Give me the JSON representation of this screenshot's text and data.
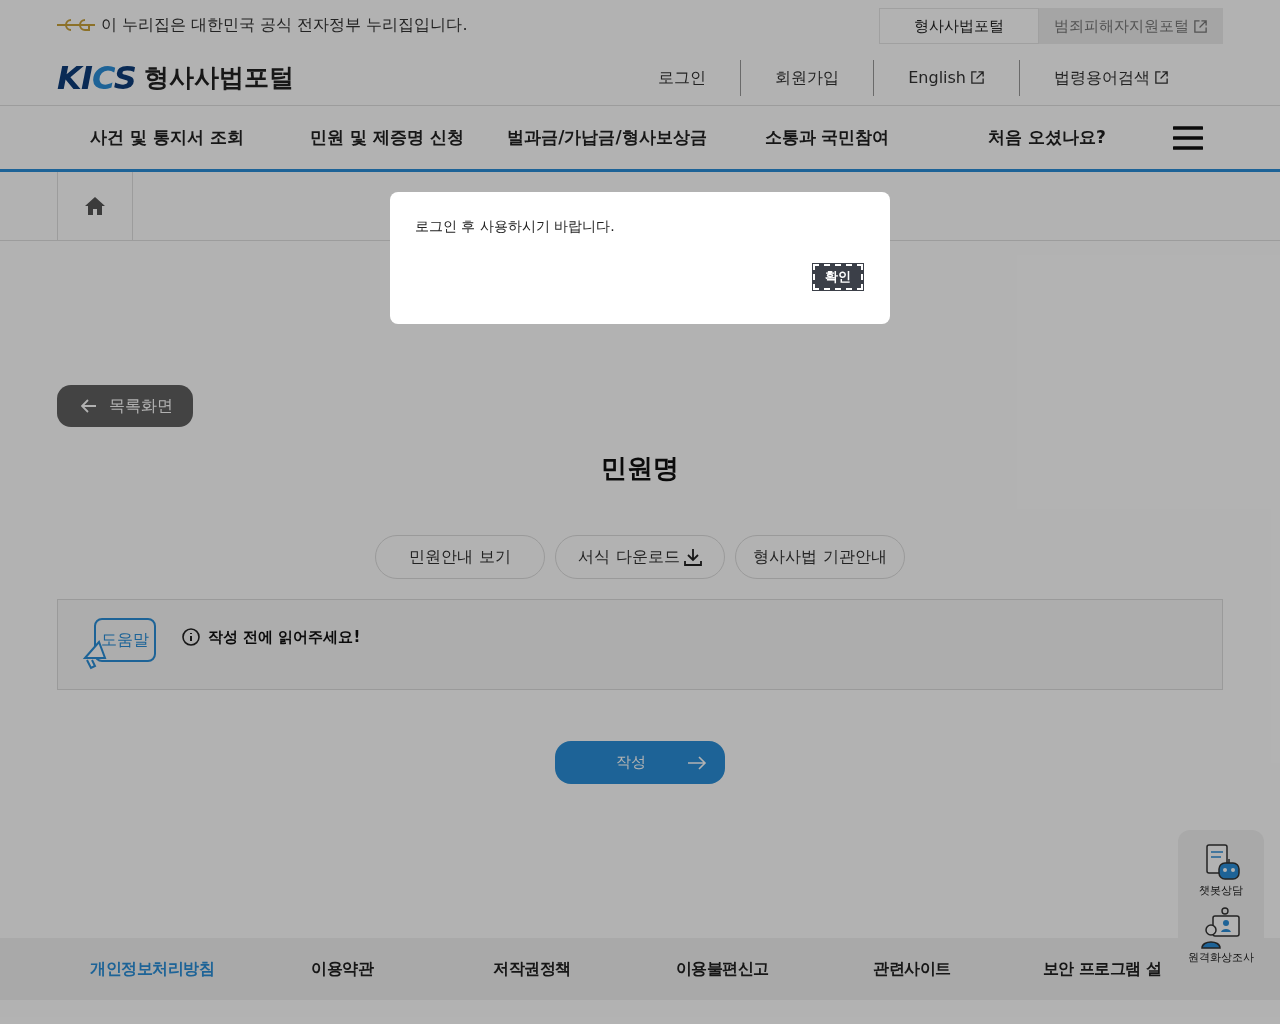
{
  "gov_banner": {
    "text": "이 누리집은 대한민국 공식 전자정부 누리집입니다."
  },
  "portal_tabs": [
    {
      "label": "형사사법포털",
      "selected": true,
      "external": false
    },
    {
      "label": "범죄피해자지원포털",
      "selected": false,
      "external": true
    }
  ],
  "logo": {
    "brand": "KICS",
    "title": "형사사법포털"
  },
  "utility_links": [
    {
      "label": "로그인",
      "external": false
    },
    {
      "label": "회원가입",
      "external": false
    },
    {
      "label": "English",
      "external": true
    },
    {
      "label": "법령용어검색",
      "external": true
    }
  ],
  "main_nav": [
    "사건 및 통지서 조회",
    "민원 및 제증명 신청",
    "벌과금/가납금/형사보상금",
    "소통과 국민참여",
    "처음 오셨나요?"
  ],
  "back_button": {
    "label": "목록화면"
  },
  "section_title": "민원명",
  "actions": [
    {
      "label": "민원안내 보기",
      "kind": "plain"
    },
    {
      "label": "서식 다운로드",
      "kind": "download"
    },
    {
      "label": "형사사법 기관안내",
      "kind": "plain"
    }
  ],
  "help_box": {
    "badge": "도움말",
    "notice": "작성 전에 읽어주세요!"
  },
  "submit_button": {
    "label": "작성"
  },
  "footer_links": [
    {
      "label": "개인정보처리방침",
      "highlighted": true
    },
    {
      "label": "이용약관",
      "highlighted": false
    },
    {
      "label": "저작권정책",
      "highlighted": false
    },
    {
      "label": "이용불편신고",
      "highlighted": false
    },
    {
      "label": "관련사이트",
      "highlighted": false
    },
    {
      "label": "보안 프로그램 설",
      "highlighted": false
    }
  ],
  "floating": [
    {
      "label": "챗봇상담",
      "kind": "chatbot"
    },
    {
      "label": "원격화상조사",
      "kind": "video"
    }
  ],
  "dialog": {
    "message": "로그인 후 사용하시기 바랍니다.",
    "confirm": "확인"
  }
}
